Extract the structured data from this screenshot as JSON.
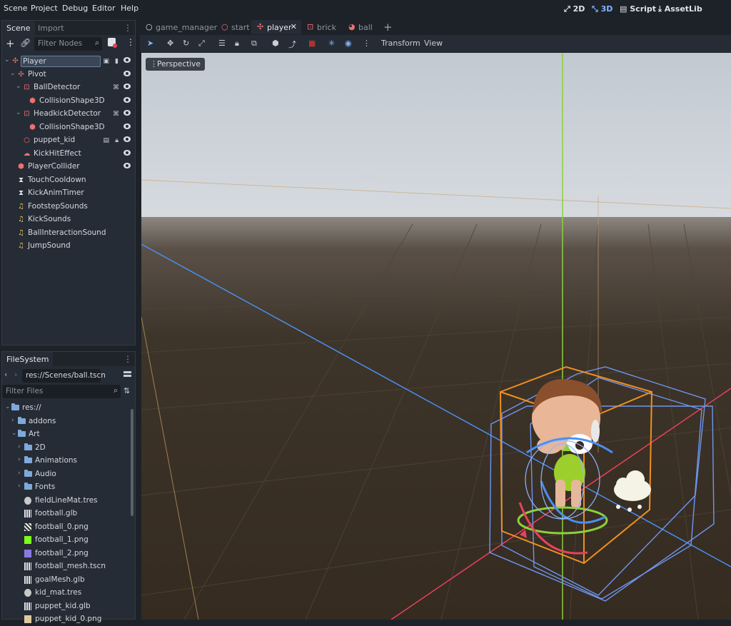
{
  "menubar": {
    "items": [
      "Scene",
      "Project",
      "Debug",
      "Editor",
      "Help"
    ],
    "workspaces": [
      {
        "label": "2D",
        "icon": "2d-icon",
        "active": false
      },
      {
        "label": "3D",
        "icon": "3d-icon",
        "active": true
      },
      {
        "label": "Script",
        "icon": "script-icon",
        "active": false
      },
      {
        "label": "AssetLib",
        "icon": "assetlib-icon",
        "active": false
      }
    ]
  },
  "scene_dock": {
    "tabs": [
      "Scene",
      "Import"
    ],
    "filter_placeholder": "Filter Nodes",
    "nodes": [
      {
        "label": "Player",
        "icon": "node3d-player-icon",
        "depth": 0,
        "selected": true
      },
      {
        "label": "Pivot",
        "icon": "node3d-icon",
        "depth": 1
      },
      {
        "label": "BallDetector",
        "icon": "area3d-icon",
        "depth": 2
      },
      {
        "label": "CollisionShape3D",
        "icon": "collision-shape-icon",
        "depth": 3
      },
      {
        "label": "HeadkickDetector",
        "icon": "area3d-icon",
        "depth": 2
      },
      {
        "label": "CollisionShape3D",
        "icon": "collision-shape-icon",
        "depth": 3
      },
      {
        "label": "puppet_kid",
        "icon": "instance-icon",
        "depth": 2
      },
      {
        "label": "KickHitEffect",
        "icon": "particles-icon",
        "depth": 2
      },
      {
        "label": "PlayerCollider",
        "icon": "collision-shape-icon",
        "depth": 1
      },
      {
        "label": "TouchCooldown",
        "icon": "timer-icon",
        "depth": 1
      },
      {
        "label": "KickAnimTimer",
        "icon": "timer-icon",
        "depth": 1
      },
      {
        "label": "FootstepSounds",
        "icon": "audio-player-icon",
        "depth": 1
      },
      {
        "label": "KickSounds",
        "icon": "audio-player-icon",
        "depth": 1
      },
      {
        "label": "BallInteractionSound",
        "icon": "audio-player-icon",
        "depth": 1
      },
      {
        "label": "JumpSound",
        "icon": "audio-player-icon",
        "depth": 1
      }
    ]
  },
  "filesystem": {
    "tab": "FileSystem",
    "path": "res://Scenes/ball.tscn",
    "filter_placeholder": "Filter Files",
    "items": [
      {
        "label": "res://",
        "type": "folder",
        "depth": 0
      },
      {
        "label": "addons",
        "type": "folder",
        "depth": 1
      },
      {
        "label": "Art",
        "type": "folder",
        "depth": 1
      },
      {
        "label": "2D",
        "type": "folder",
        "depth": 2
      },
      {
        "label": "Animations",
        "type": "folder",
        "depth": 2
      },
      {
        "label": "Audio",
        "type": "folder",
        "depth": 2
      },
      {
        "label": "Fonts",
        "type": "folder",
        "depth": 2
      },
      {
        "label": "fieldLineMat.tres",
        "type": "material",
        "depth": 2
      },
      {
        "label": "football.glb",
        "type": "scene",
        "depth": 2
      },
      {
        "label": "football_0.png",
        "type": "image-checker",
        "depth": 2
      },
      {
        "label": "football_1.png",
        "type": "image-green",
        "depth": 2
      },
      {
        "label": "football_2.png",
        "type": "image-purple",
        "depth": 2
      },
      {
        "label": "football_mesh.tscn",
        "type": "scene",
        "depth": 2
      },
      {
        "label": "goalMesh.glb",
        "type": "scene",
        "depth": 2
      },
      {
        "label": "kid_mat.tres",
        "type": "material",
        "depth": 2
      },
      {
        "label": "puppet_kid.glb",
        "type": "scene",
        "depth": 2
      },
      {
        "label": "puppet_kid_0.png",
        "type": "image",
        "depth": 2
      }
    ]
  },
  "scene_tabs": [
    {
      "label": "game_manager",
      "icon": "node-icon",
      "selected": false
    },
    {
      "label": "start",
      "icon": "node-icon",
      "selected": false
    },
    {
      "label": "player",
      "icon": "player-icon",
      "selected": true
    },
    {
      "label": "brick",
      "icon": "brick-icon",
      "selected": false
    },
    {
      "label": "ball",
      "icon": "ball-icon",
      "selected": false
    }
  ],
  "viewport_toolbar": {
    "transform_label": "Transform",
    "view_label": "View"
  },
  "viewport": {
    "perspective_label": "Perspective"
  },
  "colors": {
    "accent": "#84b5ff",
    "x_axis": "#e8425a",
    "y_axis": "#8bd13a",
    "z_axis": "#4a8ff0",
    "selection_box": "#f09020",
    "gizmo_box": "#6e96f0"
  }
}
